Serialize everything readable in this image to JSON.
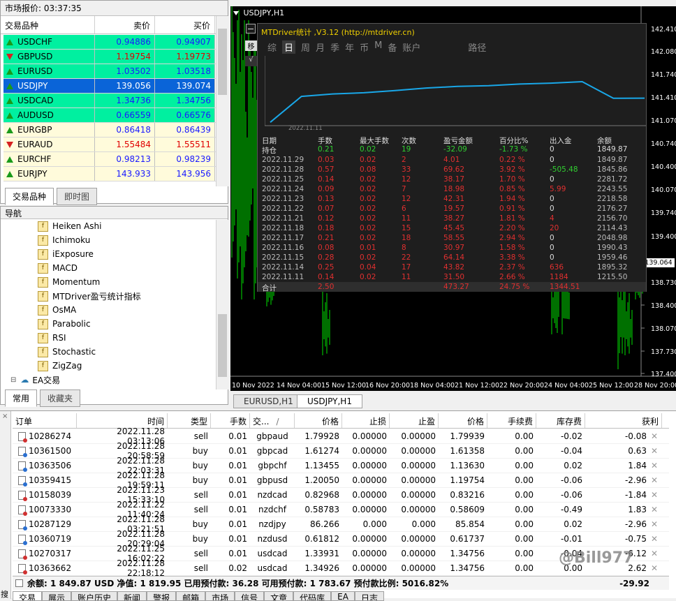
{
  "market_watch": {
    "title": "市场报价: 03:37:35",
    "headers": {
      "symbol": "交易品种",
      "bid": "卖价",
      "ask": "买价"
    },
    "rows": [
      {
        "symbol": "USDCHF",
        "bid": "0.94886",
        "ask": "0.94907",
        "dir": "up",
        "bg": "#00f0a0",
        "bidc": "#1a1aff",
        "askc": "#1a1aff"
      },
      {
        "symbol": "GBPUSD",
        "bid": "1.19754",
        "ask": "1.19773",
        "dir": "dn",
        "bg": "#00f0a0",
        "bidc": "#e00000",
        "askc": "#e00000"
      },
      {
        "symbol": "EURUSD",
        "bid": "1.03502",
        "ask": "1.03518",
        "dir": "up",
        "bg": "#00f0a0",
        "bidc": "#1a1aff",
        "askc": "#1a1aff"
      },
      {
        "symbol": "USDJPY",
        "bid": "139.056",
        "ask": "139.074",
        "dir": "up",
        "bg": "#0a64d8",
        "bidc": "#ffffff",
        "askc": "#ffffff",
        "symc": "#ffffff"
      },
      {
        "symbol": "USDCAD",
        "bid": "1.34736",
        "ask": "1.34756",
        "dir": "up",
        "bg": "#00f0a0",
        "bidc": "#1a1aff",
        "askc": "#1a1aff"
      },
      {
        "symbol": "AUDUSD",
        "bid": "0.66559",
        "ask": "0.66576",
        "dir": "up",
        "bg": "#00f0a0",
        "bidc": "#1a1aff",
        "askc": "#1a1aff"
      },
      {
        "symbol": "EURGBP",
        "bid": "0.86418",
        "ask": "0.86439",
        "dir": "up",
        "bg": "#fffbdb",
        "bidc": "#1a1aff",
        "askc": "#1a1aff"
      },
      {
        "symbol": "EURAUD",
        "bid": "1.55484",
        "ask": "1.55511",
        "dir": "dn",
        "bg": "#fffbdb",
        "bidc": "#e00000",
        "askc": "#e00000"
      },
      {
        "symbol": "EURCHF",
        "bid": "0.98213",
        "ask": "0.98239",
        "dir": "up",
        "bg": "#fffbdb",
        "bidc": "#1a1aff",
        "askc": "#1a1aff"
      },
      {
        "symbol": "EURJPY",
        "bid": "143.933",
        "ask": "143.956",
        "dir": "up",
        "bg": "#fffbdb",
        "bidc": "#1a1aff",
        "askc": "#1a1aff"
      }
    ],
    "tabs": [
      "交易品种",
      "即时图"
    ]
  },
  "navigator": {
    "title": "导航",
    "items": [
      "Heiken Ashi",
      "Ichimoku",
      "iExposure",
      "MACD",
      "Momentum",
      "MTDriver盈亏统计指标",
      "OsMA",
      "Parabolic",
      "RSI",
      "Stochastic",
      "ZigZag"
    ],
    "ea_label": "EA交易",
    "tabs": [
      "常用",
      "收藏夹"
    ]
  },
  "chart": {
    "title": "USDJPY,H1",
    "price_labels": [
      "142.410",
      "142.080",
      "141.740",
      "141.410",
      "141.070",
      "140.740",
      "140.400",
      "140.070",
      "139.740",
      "139.400",
      "139.064",
      "138.730",
      "138.400",
      "138.070",
      "137.730",
      "137.400"
    ],
    "current_price": "139.064",
    "time_labels": [
      "10 Nov 2022",
      "14 Nov 04:00",
      "15 Nov 12:00",
      "16 Nov 20:00",
      "18 Nov 04:00",
      "21 Nov 12:00",
      "22 Nov 20:00",
      "24 Nov 04:00",
      "25 Nov 12:00",
      "28 Nov 20:00"
    ],
    "tabs": [
      "EURUSD,H1",
      "USDJPY,H1"
    ],
    "side_buttons": [
      "移",
      "√"
    ]
  },
  "stats_panel": {
    "title": "MTDriver统计 ,V3.12 (http://mtdriver.cn)",
    "menu": [
      "综",
      "日",
      "周",
      "月",
      "季",
      "年",
      "币",
      "M",
      "备",
      "账户",
      "路径"
    ],
    "curve_date": "2022.11.11",
    "headers": [
      "日期",
      "手数",
      "最大手数",
      "次数",
      "盈亏金额",
      "百分比%",
      "出入金",
      "余额"
    ],
    "holding": [
      "持仓",
      "0.21",
      "0.02",
      "19",
      "-32.09",
      "-1.73 %",
      "0",
      "1849.87"
    ],
    "rows": [
      [
        "2022.11.29",
        "0.03",
        "0.02",
        "2",
        "4.01",
        "0.22 %",
        "0",
        "1849.87"
      ],
      [
        "2022.11.28",
        "0.57",
        "0.08",
        "33",
        "69.62",
        "3.92 %",
        "-505.48",
        "1845.86"
      ],
      [
        "2022.11.25",
        "0.14",
        "0.02",
        "12",
        "38.17",
        "1.70 %",
        "0",
        "2281.72"
      ],
      [
        "2022.11.24",
        "0.09",
        "0.02",
        "7",
        "18.98",
        "0.85 %",
        "5.99",
        "2243.55"
      ],
      [
        "2022.11.23",
        "0.13",
        "0.02",
        "12",
        "42.31",
        "1.94 %",
        "0",
        "2218.58"
      ],
      [
        "2022.11.22",
        "0.07",
        "0.02",
        "6",
        "19.57",
        "0.91 %",
        "0",
        "2176.27"
      ],
      [
        "2022.11.21",
        "0.12",
        "0.02",
        "11",
        "38.27",
        "1.81 %",
        "4",
        "2156.70"
      ],
      [
        "2022.11.18",
        "0.18",
        "0.02",
        "15",
        "45.45",
        "2.20 %",
        "20",
        "2114.43"
      ],
      [
        "2022.11.17",
        "0.21",
        "0.02",
        "18",
        "58.55",
        "2.94 %",
        "0",
        "2048.98"
      ],
      [
        "2022.11.16",
        "0.08",
        "0.01",
        "8",
        "30.97",
        "1.58 %",
        "0",
        "1990.43"
      ],
      [
        "2022.11.15",
        "0.28",
        "0.02",
        "22",
        "64.14",
        "3.38 %",
        "0",
        "1959.46"
      ],
      [
        "2022.11.14",
        "0.25",
        "0.04",
        "17",
        "43.82",
        "2.37 %",
        "636",
        "1895.32"
      ],
      [
        "2022.11.11",
        "0.14",
        "0.02",
        "11",
        "31.50",
        "2.66 %",
        "1184",
        "1215.50"
      ]
    ],
    "total": [
      "合计",
      "2.50",
      "",
      "",
      "473.27",
      "24.75 %",
      "1344.51",
      ""
    ]
  },
  "terminal": {
    "headers": [
      "订单",
      "时间",
      "类型",
      "手数",
      "交...",
      "价格",
      "止损",
      "止盈",
      "价格",
      "手续费",
      "库存费",
      "获利"
    ],
    "sort_mark": "/",
    "orders": [
      [
        "10286274",
        "2022.11.28 03:13:06",
        "sell",
        "0.01",
        "gbpaud",
        "1.79928",
        "0.00000",
        "0.00000",
        "1.79939",
        "0.00",
        "-0.02",
        "-0.08"
      ],
      [
        "10361500",
        "2022.11.28 20:58:59",
        "buy",
        "0.01",
        "gbpcad",
        "1.61274",
        "0.00000",
        "0.00000",
        "1.61358",
        "0.00",
        "-0.04",
        "0.63"
      ],
      [
        "10363506",
        "2022.11.28 22:03:31",
        "buy",
        "0.01",
        "gbpchf",
        "1.13455",
        "0.00000",
        "0.00000",
        "1.13630",
        "0.00",
        "0.02",
        "1.84"
      ],
      [
        "10359415",
        "2022.11.28 19:59:11",
        "buy",
        "0.01",
        "gbpusd",
        "1.20050",
        "0.00000",
        "0.00000",
        "1.19754",
        "0.00",
        "-0.06",
        "-2.96"
      ],
      [
        "10158039",
        "2022.11.23 15:33:10",
        "sell",
        "0.01",
        "nzdcad",
        "0.82968",
        "0.00000",
        "0.00000",
        "0.83216",
        "0.00",
        "-0.06",
        "-1.84"
      ],
      [
        "10073330",
        "2022.11.22 11:40:24",
        "sell",
        "0.01",
        "nzdchf",
        "0.58783",
        "0.00000",
        "0.00000",
        "0.58609",
        "0.00",
        "-0.49",
        "1.83"
      ],
      [
        "10287129",
        "2022.11.28 03:21:51",
        "buy",
        "0.01",
        "nzdjpy",
        "86.266",
        "0.000",
        "0.000",
        "85.854",
        "0.00",
        "0.02",
        "-2.96"
      ],
      [
        "10360719",
        "2022.11.28 20:29:04",
        "buy",
        "0.01",
        "nzdusd",
        "0.61812",
        "0.00000",
        "0.00000",
        "0.61737",
        "0.00",
        "-0.01",
        "-0.75"
      ],
      [
        "10270317",
        "2022.11.25 16:02:22",
        "sell",
        "0.01",
        "usdcad",
        "1.33931",
        "0.00000",
        "0.00000",
        "1.34756",
        "0.00",
        "-0.04",
        "-6.12"
      ],
      [
        "10363662",
        "2022.11.28 22:18:12",
        "sell",
        "0.02",
        "usdcad",
        "1.34926",
        "0.00000",
        "0.00000",
        "1.34756",
        "0.00",
        "0.00",
        "2.62"
      ]
    ],
    "summary": "余额: 1 849.87 USD  净值: 1 819.95  已用预付款: 36.28  可用预付款: 1 783.67  预付款比例: 5016.82%",
    "total_profit": "-29.92",
    "tabs": [
      "交易",
      "展示",
      "账户历史",
      "新闻",
      "警报",
      "邮箱",
      "市场",
      "信号",
      "文章",
      "代码库",
      "EA",
      "日志"
    ],
    "side_label": "搜索",
    "watermark": "@Bill977"
  },
  "colors": {
    "bull": "#00e000",
    "curve": "#19a7e8",
    "red": "#e03030",
    "green": "#30d030"
  }
}
